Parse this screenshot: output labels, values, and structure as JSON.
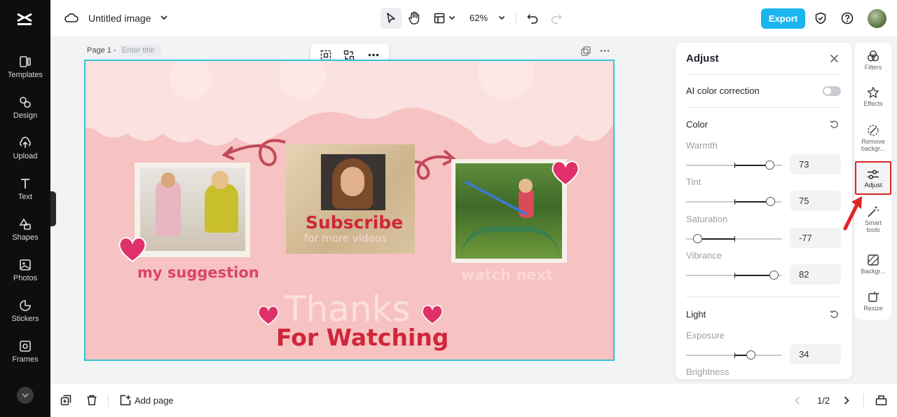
{
  "sidebar": {
    "items": [
      {
        "label": "Templates",
        "icon": "templates-icon"
      },
      {
        "label": "Design",
        "icon": "design-icon"
      },
      {
        "label": "Upload",
        "icon": "upload-icon"
      },
      {
        "label": "Text",
        "icon": "text-icon"
      },
      {
        "label": "Shapes",
        "icon": "shapes-icon"
      },
      {
        "label": "Photos",
        "icon": "photos-icon"
      },
      {
        "label": "Stickers",
        "icon": "stickers-icon"
      },
      {
        "label": "Frames",
        "icon": "frames-icon"
      }
    ]
  },
  "topbar": {
    "doc_title": "Untitled image",
    "zoom": "62%",
    "export_label": "Export"
  },
  "page": {
    "label": "Page 1 -",
    "title_placeholder": "Enter title"
  },
  "canvas": {
    "subscribe": "Subscribe",
    "subscribe_sub": "for more videos",
    "caption_left": "my suggestion",
    "caption_right": "watch next",
    "thanks": "Thanks",
    "for_watching": "For Watching"
  },
  "adjust": {
    "title": "Adjust",
    "ai_label": "AI color correction",
    "ai_enabled": false,
    "color_section": "Color",
    "light_section": "Light",
    "controls": [
      {
        "label": "Warmth",
        "value": "73",
        "level": 0.73
      },
      {
        "label": "Tint",
        "value": "75",
        "level": 0.75
      },
      {
        "label": "Saturation",
        "value": "-77",
        "level": -0.77
      },
      {
        "label": "Vibrance",
        "value": "82",
        "level": 0.82
      }
    ],
    "exposure": {
      "label": "Exposure",
      "value": "34",
      "level": 0.34
    },
    "brightness_label": "Brightness"
  },
  "rail": {
    "items": [
      {
        "label": "Filters"
      },
      {
        "label": "Effects"
      },
      {
        "label": "Remove backgr..."
      },
      {
        "label": "Adjust"
      },
      {
        "label": "Smart tools"
      },
      {
        "label": "Backgr..."
      },
      {
        "label": "Resize"
      }
    ]
  },
  "bottom": {
    "add_page_label": "Add page",
    "page_indicator": "1/2"
  },
  "colors": {
    "accent": "#1bb5f0",
    "selection": "#30c6d6",
    "highlight": "#e02424",
    "canvas_bg": "#f7c2c2",
    "title_red": "#d0263a"
  }
}
